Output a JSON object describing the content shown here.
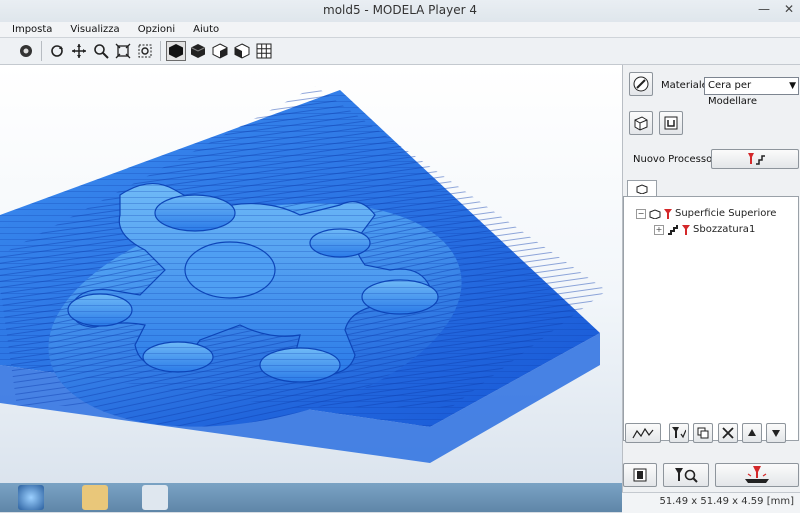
{
  "window": {
    "title": "mold5 - MODELA Player 4",
    "controls": [
      "minimize-icon",
      "close-icon"
    ]
  },
  "menu": {
    "items": [
      "Imposta",
      "Visualizza",
      "Opzioni",
      "Aiuto"
    ]
  },
  "toolbar": {
    "icons": [
      "dot-view-icon",
      "rotate-icon",
      "move-icon",
      "zoom-icon",
      "fit-icon",
      "zoom-box-icon",
      "shaded-cube-icon",
      "solid-cube-icon",
      "front-cube-icon",
      "side-cube-icon",
      "grid-icon"
    ]
  },
  "panel": {
    "material_label": "Materiale",
    "material_value": "Cera per Modellare",
    "new_process_label": "Nuovo Processo",
    "tree": {
      "root_label": "Superficie Superiore",
      "child_label": "Sbozzatura1",
      "root_expander": "−",
      "child_expander": "+"
    },
    "action_icons": [
      "path-preview-icon",
      "tool-edit-icon",
      "copy-icon",
      "delete-icon",
      "move-up-icon",
      "move-down-icon"
    ],
    "bottom_icons": [
      "stop-icon",
      "preview-cut-icon",
      "cut-icon"
    ]
  },
  "status": {
    "dimensions": "51.49 x 51.49 x 4.59 [mm]"
  },
  "colors": {
    "toolpath_blue": "#1f6fe0",
    "model_blue": "#3f9af2",
    "accent_red": "#d4282a"
  }
}
